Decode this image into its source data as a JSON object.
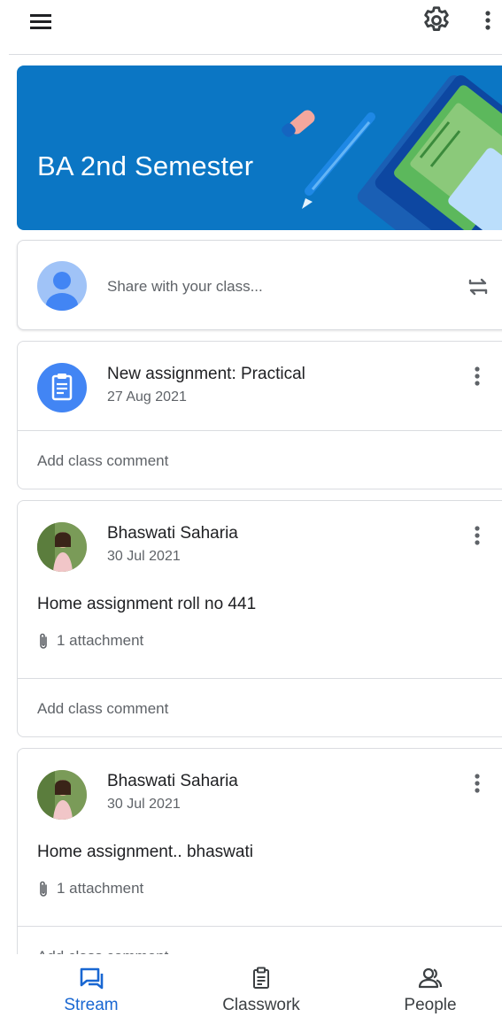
{
  "colors": {
    "banner": "#0b76c4",
    "accent": "#1967d2",
    "assignment_icon_bg": "#4285f4"
  },
  "header": {
    "menu_icon": "menu-icon",
    "settings_icon": "gear-icon",
    "more_icon": "more-vert-icon"
  },
  "banner": {
    "class_title": "BA 2nd Semester"
  },
  "share": {
    "placeholder": "Share with your class...",
    "repost_icon": "repost-icon"
  },
  "posts": [
    {
      "title": "New assignment: Practical",
      "date": "27 Aug 2021",
      "icon": "assignment-icon",
      "comment": "Add class comment"
    },
    {
      "author": "Bhaswati Saharia",
      "date": "30 Jul 2021",
      "body": "Home assignment roll no 441",
      "attachment": "1 attachment",
      "comment": "Add class comment"
    },
    {
      "author": "Bhaswati Saharia",
      "date": "30 Jul 2021",
      "body": "Home assignment.. bhaswati",
      "attachment": "1 attachment",
      "comment": "Add class comment"
    }
  ],
  "nav": {
    "stream": "Stream",
    "classwork": "Classwork",
    "people": "People",
    "active": "stream"
  }
}
